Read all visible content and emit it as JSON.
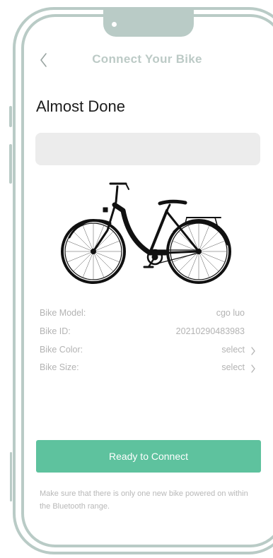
{
  "header": {
    "title": "Connect Your Bike",
    "back_icon": "chevron-left-icon"
  },
  "page": {
    "heading": "Almost Done",
    "name_box_value": ""
  },
  "bike": {
    "image_icon": "city-bike-illustration"
  },
  "details": {
    "model": {
      "label": "Bike Model:",
      "value": "cgo luo"
    },
    "id": {
      "label": "Bike ID:",
      "value": "20210290483983"
    },
    "color": {
      "label": "Bike Color:",
      "value": "select",
      "icon": "chevron-right-icon"
    },
    "size": {
      "label": "Bike Size:",
      "value": "select",
      "icon": "chevron-right-icon"
    }
  },
  "actions": {
    "connect_label": "Ready to Connect"
  },
  "footer": {
    "hint": "Make sure that there is only one new bike powered on within the Bluetooth range."
  },
  "colors": {
    "accent": "#5ec29e",
    "frame": "#b9cbc6",
    "title_muted": "#bccac6",
    "text_muted": "#b3b3b3",
    "field_bg": "#ececec"
  }
}
